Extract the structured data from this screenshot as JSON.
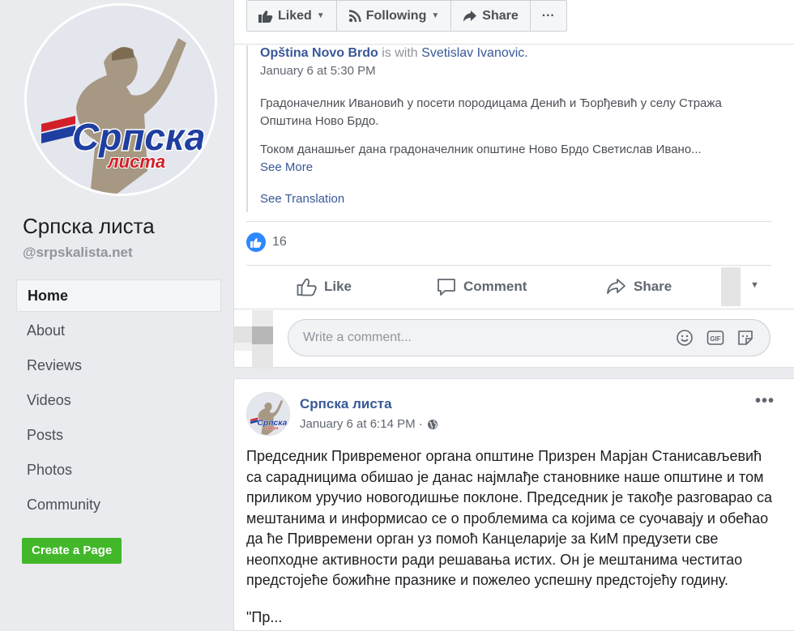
{
  "sidebar": {
    "page_name": "Српска листа",
    "handle": "@srpskalista.net",
    "logo_text": "Српска",
    "logo_subtext": "листа",
    "nav": [
      "Home",
      "About",
      "Reviews",
      "Videos",
      "Posts",
      "Photos",
      "Community"
    ],
    "create_page_label": "Create a Page"
  },
  "top_actions": {
    "liked_label": "Liked",
    "following_label": "Following",
    "share_label": "Share",
    "more_label": "···"
  },
  "shared_post": {
    "author": "Opština Novo Brdo",
    "with_text": "is with",
    "tagged": "Svetislav Ivanovic.",
    "time": "January 6 at 5:30 PM",
    "paragraph1": "Градоначелник Ивановић у посети породицама Денић и Ђорђевић у селу Стража Општина Ново Брдо.",
    "paragraph2": "Током данашњег дана градоначелник општине Ново Брдо Светислав Ивано...",
    "see_more": "See More",
    "see_translation": "See Translation"
  },
  "reactions": {
    "like_count": "16"
  },
  "actions": {
    "like": "Like",
    "comment": "Comment",
    "share": "Share"
  },
  "comment": {
    "placeholder": "Write a comment..."
  },
  "post": {
    "author": "Српска листа",
    "time": "January 6 at 6:14 PM · ",
    "menu": "•••",
    "body": "Председник Привременог органа општине Призрен Марјан Станисављевић са сарадницима обишао је данас најмлађе становнике наше општине и том приликом уручио новогодишње поклоне. Председник је такође разговарао са мештанима и информисао се о проблемима са којима се суочавају и обећао да ће Привремени орган уз помоћ Канцеларије за КиМ предузети све неопходне активности ради решавања истих. Он је мештанима честитао предстојеће божићне празнике и пожелео успешну предстојећу годину.",
    "cut_line": "\"Пр..."
  },
  "colors": {
    "link_blue": "#385898",
    "like_blue": "#2d88ff",
    "create_green": "#42b72a",
    "logo_blue": "#1f3fa0",
    "logo_red": "#d1202a",
    "background": "#e9ebee"
  },
  "icons": {
    "liked": "thumbs-up-icon",
    "following": "rss-icon",
    "share": "share-arrow-icon",
    "comment": "speech-bubble-icon",
    "emoji": "smiley-icon",
    "gif": "gif-icon",
    "sticker": "sticker-icon",
    "globe": "globe-icon"
  }
}
